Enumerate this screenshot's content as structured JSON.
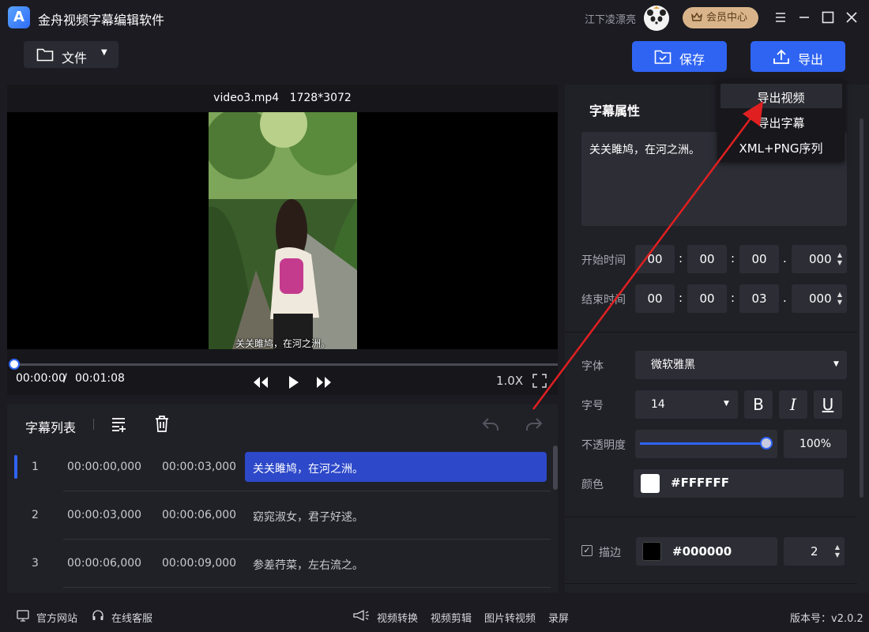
{
  "app": {
    "title": "金舟视频字幕编辑软件",
    "username": "江下凌漂亮",
    "member_center": "会员中心"
  },
  "toolbar": {
    "file_label": "文件",
    "save_label": "保存",
    "export_label": "导出"
  },
  "export_menu": {
    "items": [
      "导出视频",
      "导出字幕",
      "XML+PNG序列"
    ]
  },
  "preview": {
    "video_name": "video3.mp4",
    "resolution": "1728*3072",
    "overlay_subtitle": "关关雎鸠，在河之洲。",
    "current_time": "00:00:00",
    "separator": "/",
    "total_time": "00:01:08",
    "speed": "1.0X",
    "progress": 0.0
  },
  "subtitle_list": {
    "title": "字幕列表",
    "rows": [
      {
        "index": "1",
        "start": "00:00:00,000",
        "end": "00:00:03,000",
        "text": "关关雎鸠，在河之洲。"
      },
      {
        "index": "2",
        "start": "00:00:03,000",
        "end": "00:00:06,000",
        "text": "窈窕淑女，君子好逑。"
      },
      {
        "index": "3",
        "start": "00:00:06,000",
        "end": "00:00:09,000",
        "text": "参差荇菜，左右流之。"
      }
    ],
    "selected_index": 0
  },
  "properties": {
    "title": "字幕属性",
    "text": "关关雎鸠，在河之洲。",
    "start_label": "开始时间",
    "start": {
      "h": "00",
      "m": "00",
      "s": "00",
      "ms": "000"
    },
    "end_label": "结束时间",
    "end": {
      "h": "00",
      "m": "00",
      "s": "03",
      "ms": "000"
    },
    "colon": ":",
    "dot": ".",
    "font_label": "字体",
    "font_value": "微软雅黑",
    "size_label": "字号",
    "size_value": "14",
    "bold": "B",
    "italic": "I",
    "underline": "U",
    "opacity_label": "不透明度",
    "opacity_value": "100%",
    "opacity_fraction": 1.0,
    "color_label": "颜色",
    "color_hex": "#FFFFFF",
    "stroke_label": "描边",
    "stroke_checked": true,
    "stroke_hex": "#000000",
    "stroke_width": "2"
  },
  "statusbar": {
    "website": "官方网站",
    "support": "在线客服",
    "video_convert": "视频转换",
    "video_edit": "视频剪辑",
    "image_to_video": "图片转视频",
    "record": "录屏",
    "version": "版本号：v2.0.2"
  },
  "colors": {
    "accent": "#2f64f3",
    "selected_row": "#2d48c9",
    "member_gold": "#d9b48a",
    "annotation_arrow": "#e02020"
  }
}
